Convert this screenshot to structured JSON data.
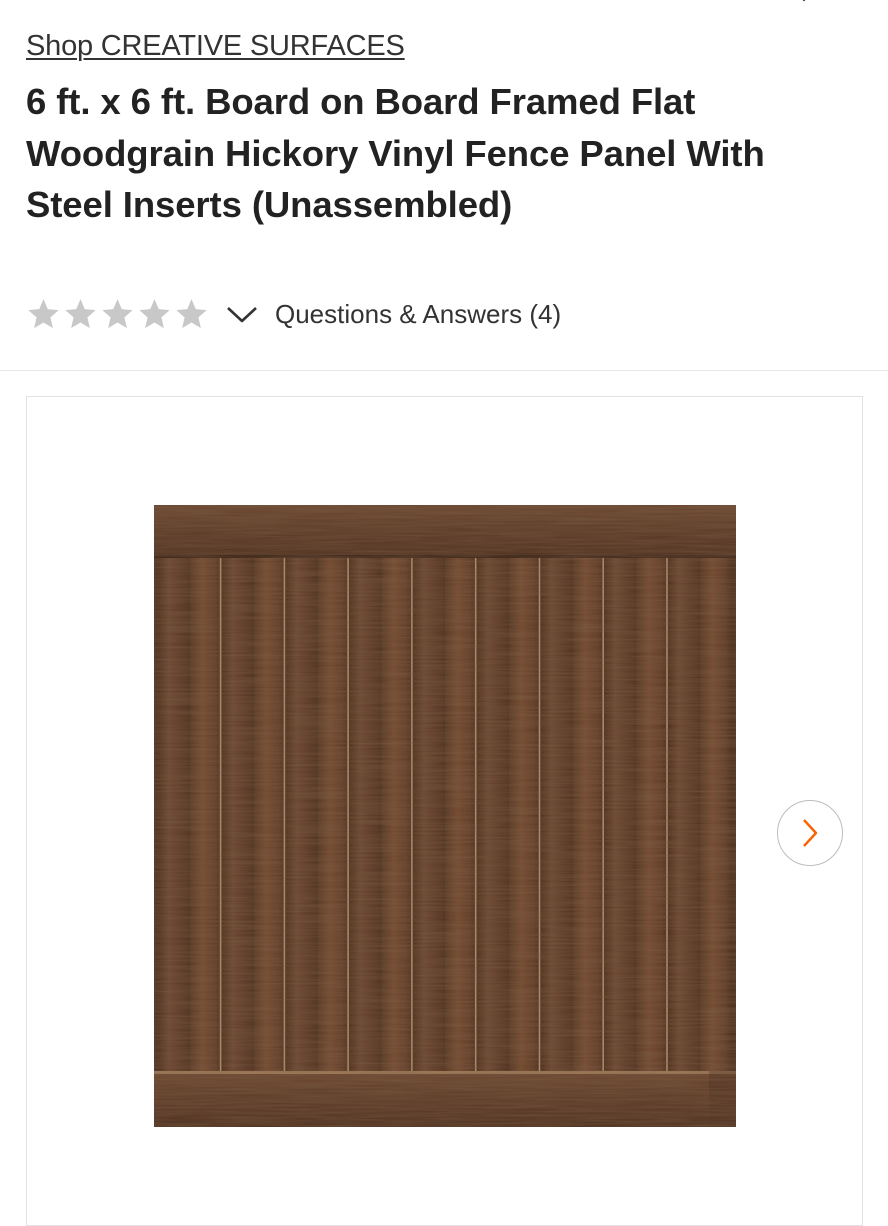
{
  "header": {
    "brand_link": "Shop CREATIVE SURFACES",
    "title": "6 ft. x 6 ft. Board on Board Framed Flat Woodgrain Hickory Vinyl Fence Panel With Steel Inserts (Unassembled)"
  },
  "rating": {
    "stars_filled": 0,
    "stars_total": 5,
    "star_color": "#c8c8c8",
    "questions_answers": "Questions & Answers (4)"
  },
  "gallery": {
    "image_icon": "fence-panel-image",
    "next_icon": "chevron-right-icon",
    "accent_color": "#f96302"
  },
  "colors": {
    "fence_main": "#5c3a26",
    "fence_dark": "#46291a",
    "fence_light": "#7a5238"
  }
}
